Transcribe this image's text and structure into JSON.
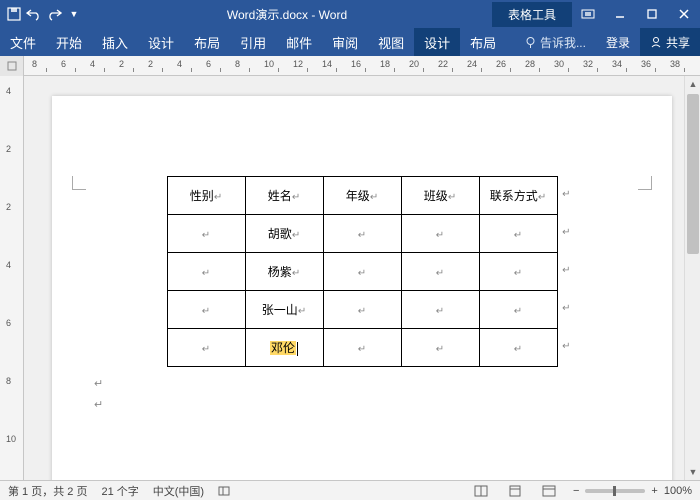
{
  "title_bar": {
    "document_title": "Word演示.docx - Word",
    "context_tab": "表格工具"
  },
  "ribbon": {
    "tabs": [
      "文件",
      "开始",
      "插入",
      "设计",
      "布局",
      "引用",
      "邮件",
      "审阅",
      "视图",
      "设计",
      "布局"
    ],
    "active_index": 9,
    "tell_me": "告诉我...",
    "login": "登录",
    "share": "共享"
  },
  "ruler_h": {
    "numbers": [
      "8",
      "6",
      "4",
      "2",
      "2",
      "4",
      "6",
      "8",
      "10",
      "12",
      "14",
      "16",
      "18",
      "20",
      "22",
      "24",
      "26",
      "28",
      "30",
      "32",
      "34",
      "36",
      "38"
    ]
  },
  "ruler_v": {
    "numbers": [
      "4",
      "2",
      "2",
      "4",
      "6",
      "8",
      "10"
    ]
  },
  "table": {
    "headers": [
      "性别",
      "姓名",
      "年级",
      "班级",
      "联系方式"
    ],
    "rows": [
      [
        "",
        "胡歌",
        "",
        "",
        ""
      ],
      [
        "",
        "杨紫",
        "",
        "",
        ""
      ],
      [
        "",
        "张一山",
        "",
        "",
        ""
      ],
      [
        "",
        "邓伦",
        "",
        "",
        ""
      ]
    ],
    "highlighted": {
      "row": 3,
      "col": 1
    }
  },
  "status": {
    "page": "第 1 页，共 2 页",
    "words": "21 个字",
    "lang": "中文(中国)",
    "zoom": "100%"
  }
}
